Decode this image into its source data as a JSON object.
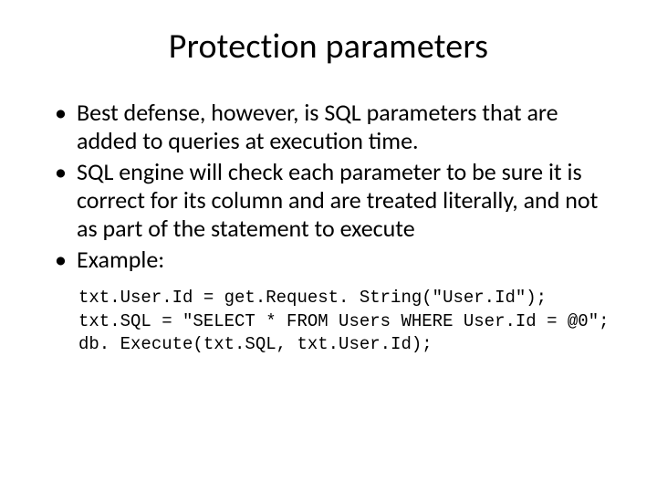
{
  "title": "Protection parameters",
  "bullets": [
    "Best defense, however, is SQL parameters that are added to queries at execution time.",
    "SQL engine will check each parameter to be sure it is correct for its column and are treated literally, and not as part of the statement to execute",
    "Example:"
  ],
  "code": "txt.User.Id = get.Request. String(\"User.Id\");\ntxt.SQL = \"SELECT * FROM Users WHERE User.Id = @0\";\ndb. Execute(txt.SQL, txt.User.Id);"
}
